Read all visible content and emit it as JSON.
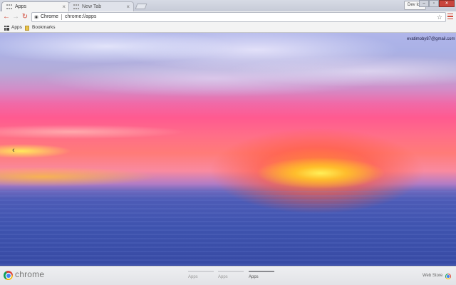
{
  "browser": {
    "tabs": [
      {
        "label": "Apps",
        "active": true
      },
      {
        "label": "New Tab",
        "active": false
      }
    ],
    "user_badge": "Dev Ide",
    "window_controls": [
      "minimize",
      "maximize",
      "close"
    ]
  },
  "toolbar": {
    "back_icon": "back-arrow-icon",
    "forward_icon": "forward-arrow-icon",
    "reload_icon": "reload-icon",
    "site_chip_label": "Chrome",
    "url": "chrome://apps",
    "accent_color": "#d24a3a"
  },
  "bookmarks_bar": {
    "apps_label": "Apps",
    "bookmarks_label": "Bookmarks"
  },
  "page": {
    "account_email": "evatimoby87@gmail.com",
    "background": "sunset over ocean"
  },
  "footer": {
    "brand": "chrome",
    "pages": [
      {
        "label": "Apps",
        "active": false
      },
      {
        "label": "Apps",
        "active": false
      },
      {
        "label": "Apps",
        "active": true
      }
    ],
    "webstore_label": "Web Store"
  }
}
